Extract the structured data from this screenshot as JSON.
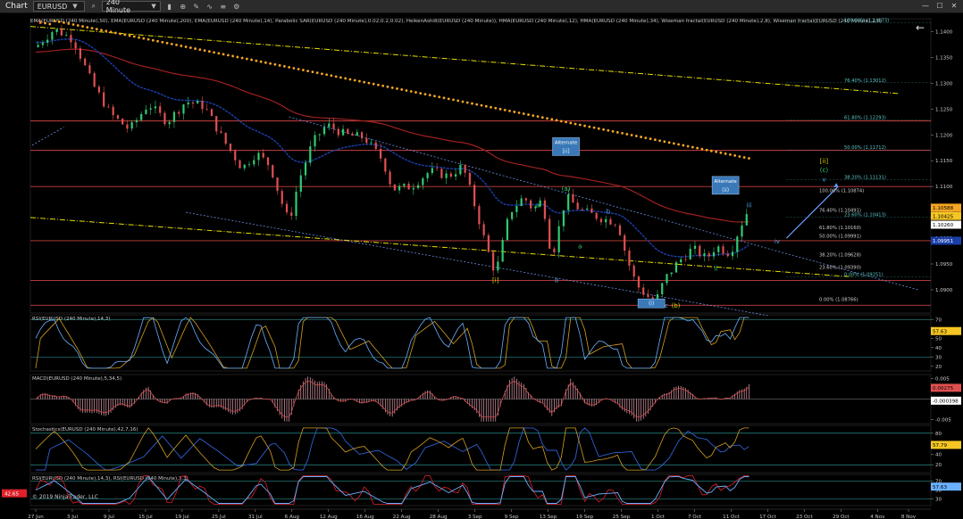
{
  "app": {
    "title": "Chart",
    "symbol": "EURUSD",
    "interval": "240 Minute"
  },
  "indicator_header": "EMA(EURUSD (240 Minute),50), EMA(EURUSD (240 Minute),200), EMA(EURUSD (240 Minute),14), Parabolic SAR(EURUSD (240 Minute),0.02,0.2,0.02), HeikenAshi8(EURUSD (240 Minute)), HMA(EURUSD (240 Minute),12), HMA(EURUSD (240 Minute),34), Wiseman fractal(EURUSD (240 Minute),2,8), Wiseman fractal(EURUSD (240 Minute),2,8)",
  "copyright": "© 2019 NinjaTrader, LLC",
  "colors": {
    "bull": "#2ecc71",
    "bear": "#e05050",
    "sar": "#f5a623",
    "ema50": "#1a3fa8",
    "ema200": "#a02020",
    "hline": "#c84040",
    "channel": "#e8e000",
    "blue_dotted": "#6a8ee0"
  },
  "chart_data": [
    {
      "type": "line",
      "name": "price",
      "title": "EURUSD (240 Minute)",
      "ylim": [
        1.0855,
        1.1425
      ],
      "y_ticks": [
        "1.1400",
        "1.1350",
        "1.1300",
        "1.1250",
        "1.1200",
        "1.1150",
        "1.1100",
        "1.1050",
        "1.1000",
        "1.0950",
        "1.0900"
      ],
      "x_ticks": [
        "27 Jun",
        "3 Jul",
        "9 Jul",
        "15 Jul",
        "19 Jul",
        "25 Jul",
        "31 Jul",
        "6 Aug",
        "12 Aug",
        "16 Aug",
        "22 Aug",
        "28 Aug",
        "3 Sep",
        "9 Sep",
        "13 Sep",
        "19 Sep",
        "25 Sep",
        "1 Oct",
        "7 Oct",
        "11 Oct",
        "17 Oct",
        "23 Oct",
        "29 Oct",
        "4 Nov",
        "8 Nov"
      ],
      "price_path": [
        [
          0,
          1.137
        ],
        [
          2,
          1.1405
        ],
        [
          4,
          1.1385
        ],
        [
          6,
          1.13
        ],
        [
          8,
          1.124
        ],
        [
          10,
          1.121
        ],
        [
          12,
          1.126
        ],
        [
          14,
          1.1225
        ],
        [
          16,
          1.1265
        ],
        [
          18,
          1.1255
        ],
        [
          20,
          1.119
        ],
        [
          22,
          1.1135
        ],
        [
          23.5,
          1.1165
        ],
        [
          25,
          1.114
        ],
        [
          26,
          1.108
        ],
        [
          27,
          1.103
        ],
        [
          28,
          1.111
        ],
        [
          29.5,
          1.1185
        ],
        [
          31,
          1.122
        ],
        [
          33,
          1.12
        ],
        [
          35,
          1.1195
        ],
        [
          37,
          1.115
        ],
        [
          38,
          1.1095
        ],
        [
          40,
          1.11
        ],
        [
          42,
          1.113
        ],
        [
          44,
          1.112
        ],
        [
          45.5,
          1.114
        ],
        [
          47,
          1.105
        ],
        [
          48,
          1.0985
        ],
        [
          49,
          1.093
        ],
        [
          50.5,
          1.105
        ],
        [
          52,
          1.108
        ],
        [
          53,
          1.1055
        ],
        [
          54,
          1.1075
        ],
        [
          55,
          1.096
        ],
        [
          56.5,
          1.108
        ],
        [
          58,
          1.1055
        ],
        [
          60,
          1.104
        ],
        [
          62,
          1.103
        ],
        [
          63,
          1.096
        ],
        [
          64,
          1.091
        ],
        [
          65,
          1.089
        ],
        [
          66,
          1.0875
        ],
        [
          67,
          1.092
        ],
        [
          68.5,
          1.0955
        ],
        [
          70,
          1.098
        ],
        [
          71.5,
          1.096
        ],
        [
          72.5,
          1.0985
        ],
        [
          74,
          1.097
        ],
        [
          75,
          1.102
        ],
        [
          76,
          1.1058
        ]
      ],
      "channel_label_points": "0.00% (1.08766)",
      "horizontal_lines": [
        1.1227,
        1.117,
        1.11,
        1.0995,
        1.0918,
        1.087
      ],
      "fib_levels_right": [
        {
          "label": "100.00% (1.14173)",
          "value": 1.1417
        },
        {
          "label": "76.40% (1.13012)",
          "value": 1.1301
        },
        {
          "label": "61.80% (1.12293)",
          "value": 1.1229
        },
        {
          "label": "50.00% (1.11712)",
          "value": 1.1171
        },
        {
          "label": "38.20% (1.11131)",
          "value": 1.1113
        },
        {
          "label": "23.60% (1.10413)",
          "value": 1.1041
        },
        {
          "label": "0.00% (1.09251)",
          "value": 1.0925
        }
      ],
      "fib_levels_left": [
        {
          "label": "100.00% (1.10874)",
          "value": 1.1087
        },
        {
          "label": "76.40% (1.10491)",
          "value": 1.1049
        },
        {
          "label": "61.80% (1.10160)",
          "value": 1.1016
        },
        {
          "label": "50.00% (1.09991)",
          "value": 1.0999
        },
        {
          "label": "38.20% (1.09628)",
          "value": 1.0963
        },
        {
          "label": "23.60% (1.09390)",
          "value": 1.0939
        },
        {
          "label": "0.00% (1.08766)",
          "value": 1.0877
        }
      ],
      "price_labels": [
        {
          "text": "1.10588",
          "value": 1.1059,
          "color": "#f5a623"
        },
        {
          "text": "1.10425",
          "value": 1.1043,
          "color": "#f5c623"
        },
        {
          "text": "1.10260",
          "value": 1.1026,
          "color": "#ffffff"
        },
        {
          "text": "1.09951",
          "value": 1.0995,
          "color": "#1a3fa8"
        }
      ],
      "wave_labels": [
        {
          "text": "z",
          "x": 0.5,
          "y": 1.1415,
          "color": "#e05050"
        },
        {
          "text": "[i]",
          "x": 49,
          "y": 1.0915,
          "color": "#d4d000"
        },
        {
          "text": "(a)",
          "x": 56.5,
          "y": 1.1092,
          "color": "#2ecc71"
        },
        {
          "text": "a",
          "x": 53.5,
          "y": 1.106,
          "color": "#2ecc71"
        },
        {
          "text": "b",
          "x": 55.5,
          "y": 1.0915,
          "color": "#4aa0e0"
        },
        {
          "text": "a",
          "x": 58,
          "y": 1.098,
          "color": "#2ecc71"
        },
        {
          "text": "b",
          "x": 61,
          "y": 1.1048,
          "color": "#4aa0e0"
        },
        {
          "text": "c",
          "x": 67.2,
          "y": 1.0865,
          "color": "#4aa0e0"
        },
        {
          "text": "(b)",
          "x": 68.2,
          "y": 1.0865,
          "color": "#d4d000"
        },
        {
          "text": "iii",
          "x": 76,
          "y": 1.106,
          "color": "#4aa0e0"
        },
        {
          "text": "iv",
          "x": 79,
          "y": 1.099,
          "color": "#4aa0e0"
        },
        {
          "text": "ii",
          "x": 72.5,
          "y": 1.0937,
          "color": "#2ecc71"
        },
        {
          "text": "[ii]",
          "x": 84,
          "y": 1.1145,
          "color": "#d4d000"
        },
        {
          "text": "(c)",
          "x": 84,
          "y": 1.1128,
          "color": "#2ecc71"
        },
        {
          "text": "v",
          "x": 84,
          "y": 1.111,
          "color": "#4aa0e0"
        }
      ],
      "alternate_boxes": [
        {
          "title": "Alternate",
          "sub": "[ii]",
          "x": 56.5,
          "y": 1.116
        },
        {
          "title": "Alternate",
          "sub": "(ii)",
          "x": 73.5,
          "y": 1.1085
        },
        {
          "title": "",
          "sub": "(i)",
          "x": 65.6,
          "y": 1.0865
        }
      ]
    },
    {
      "type": "line",
      "name": "rsi",
      "title": "RSI(EURUSD (240 Minute),14,3)",
      "ylim": [
        15,
        75
      ],
      "y_ticks": [
        "70",
        "60",
        "50",
        "40",
        "30",
        "20"
      ],
      "last_value": "57.63"
    },
    {
      "type": "bar",
      "name": "macd",
      "title": "MACD(EURUSD (240 Minute),5,34,5)",
      "ylim": [
        -0.006,
        0.006
      ],
      "y_ticks": [
        "0.005",
        "0",
        "-0.005"
      ],
      "last_values": [
        "0.00275",
        "-0.000398"
      ]
    },
    {
      "type": "line",
      "name": "stochastics",
      "title": "Stochastics(EURUSD (240 Minute),42,7,16)",
      "ylim": [
        5,
        95
      ],
      "y_ticks": [
        "80",
        "60",
        "40",
        "20"
      ],
      "last_value": "57.79"
    },
    {
      "type": "line",
      "name": "rsi2",
      "title": "RSI(EURUSD (240 Minute),14,3), RSI(EURUSD (240 Minute),3,3)",
      "ylim": [
        15,
        85
      ],
      "y_ticks": [
        "70",
        "50",
        "30"
      ],
      "last_values": [
        "57.63",
        "42.65"
      ]
    }
  ]
}
